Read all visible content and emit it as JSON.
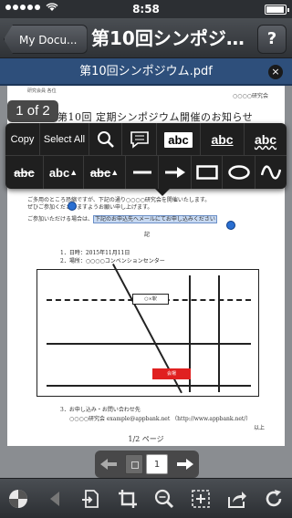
{
  "status": {
    "time": "8:58",
    "battery_level": 0.95
  },
  "nav": {
    "back_label": "My Docu...",
    "title": "第10回シンポジウ...",
    "help_label": "?"
  },
  "titlebar": {
    "filename": "第10回シンポジウム.pdf",
    "close_label": "×"
  },
  "pager_badge": "1 of 2",
  "document": {
    "sender": "研究会員 各位",
    "org_right": "○○○○研究会",
    "heading": "第10回 定期シンポジウム開催のお知らせ",
    "para1": "ご多用のところ恐縮ですが、下記の通り○○○○研究会を開催いたします。",
    "para2": "ぜひご参加くださいますようお願い申し上げます。",
    "para3_prefix": "ご参加いただける場合は、",
    "para3_selected": "下記のお申込先へメールにてお申し込みください",
    "ki": "記",
    "item1": "1．日時：2015年11月11日",
    "item2": "2．場所：○○○○コンベンションセンター",
    "map_station": "○×駅",
    "map_venue": "会場",
    "item3": "3．お申し込み・お問い合わせ先",
    "contact": "○○○○研究会 example@appbank.net （http://www.appbank.net/）",
    "closing": "以上"
  },
  "popup": {
    "row1": [
      {
        "name": "copy-button",
        "label": "Copy"
      },
      {
        "name": "select-all-button",
        "label": "Select All"
      },
      {
        "name": "search-icon",
        "label": ""
      },
      {
        "name": "comment-icon",
        "label": ""
      },
      {
        "name": "highlight-abc-button",
        "label": "abc"
      },
      {
        "name": "underline-abc-button",
        "label": "abc"
      },
      {
        "name": "squiggly-abc-button",
        "label": "abc"
      }
    ],
    "row2": [
      {
        "name": "strikethrough-abc-button",
        "label": "abc"
      },
      {
        "name": "insert-text-button",
        "label": "abc"
      },
      {
        "name": "replace-text-button",
        "label": "abc"
      },
      {
        "name": "line-tool-icon",
        "label": ""
      },
      {
        "name": "arrow-tool-icon",
        "label": ""
      },
      {
        "name": "rectangle-tool-icon",
        "label": ""
      },
      {
        "name": "ellipse-tool-icon",
        "label": ""
      },
      {
        "name": "freehand-tool-icon",
        "label": ""
      }
    ]
  },
  "page_indicator": "1/2 ページ",
  "page_nav": {
    "current_value": "1"
  },
  "toolbar": [
    "color-wheel-icon",
    "back-arrow-icon",
    "import-icon",
    "crop-icon",
    "zoom-icon",
    "select-area-icon",
    "share-icon",
    "refresh-icon"
  ]
}
